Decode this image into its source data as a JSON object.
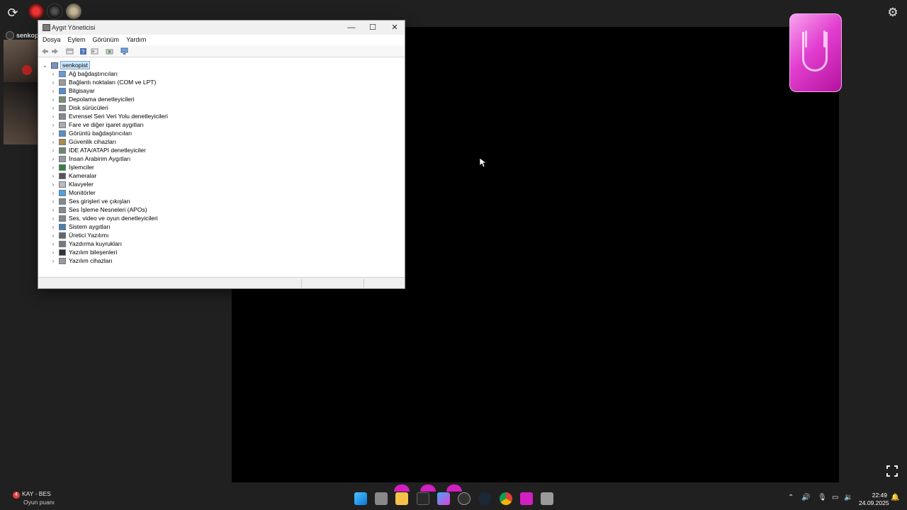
{
  "overlay": {
    "sync_icon": "sync-icon",
    "settings_icon": "gear-icon",
    "user_name": "senkopist",
    "fullscreen_icon": "fullscreen-icon"
  },
  "window": {
    "title": "Aygıt Yöneticisi",
    "menu": [
      "Dosya",
      "Eylem",
      "Görünüm",
      "Yardım"
    ],
    "root": "senkopist",
    "items": [
      "Ağ bağdaştırıcıları",
      "Bağlantı noktaları (COM ve LPT)",
      "Bilgisayar",
      "Depolama denetleyicileri",
      "Disk sürücüleri",
      "Evrensel Seri Veri Yolu denetleyicileri",
      "Fare ve diğer işaret aygıtları",
      "Görüntü bağdaştırıcıları",
      "Güvenlik cihazları",
      "IDE ATA/ATAPI denetleyiciler",
      "İnsan Arabirim Aygıtları",
      "İşlemciler",
      "Kameralar",
      "Klavyeler",
      "Monitörler",
      "Ses girişleri ve çıkışları",
      "Ses İşleme Nesneleri (APOs)",
      "Ses, video ve oyun denetleyicileri",
      "Sistem aygıtları",
      "Üretici Yazılımı",
      "Yazdırma kuyrukları",
      "Yazılım bileşenleri",
      "Yazılım cihazları"
    ]
  },
  "score": {
    "badge": "4",
    "label": "KAY - BES",
    "sub": "Oyun puanı"
  },
  "clock": {
    "time": "22:49",
    "date": "24.09.2025"
  },
  "colors": {
    "accent_pink": "#d21fbf",
    "window_bg": "#ffffff",
    "desktop_bg": "#202020"
  }
}
